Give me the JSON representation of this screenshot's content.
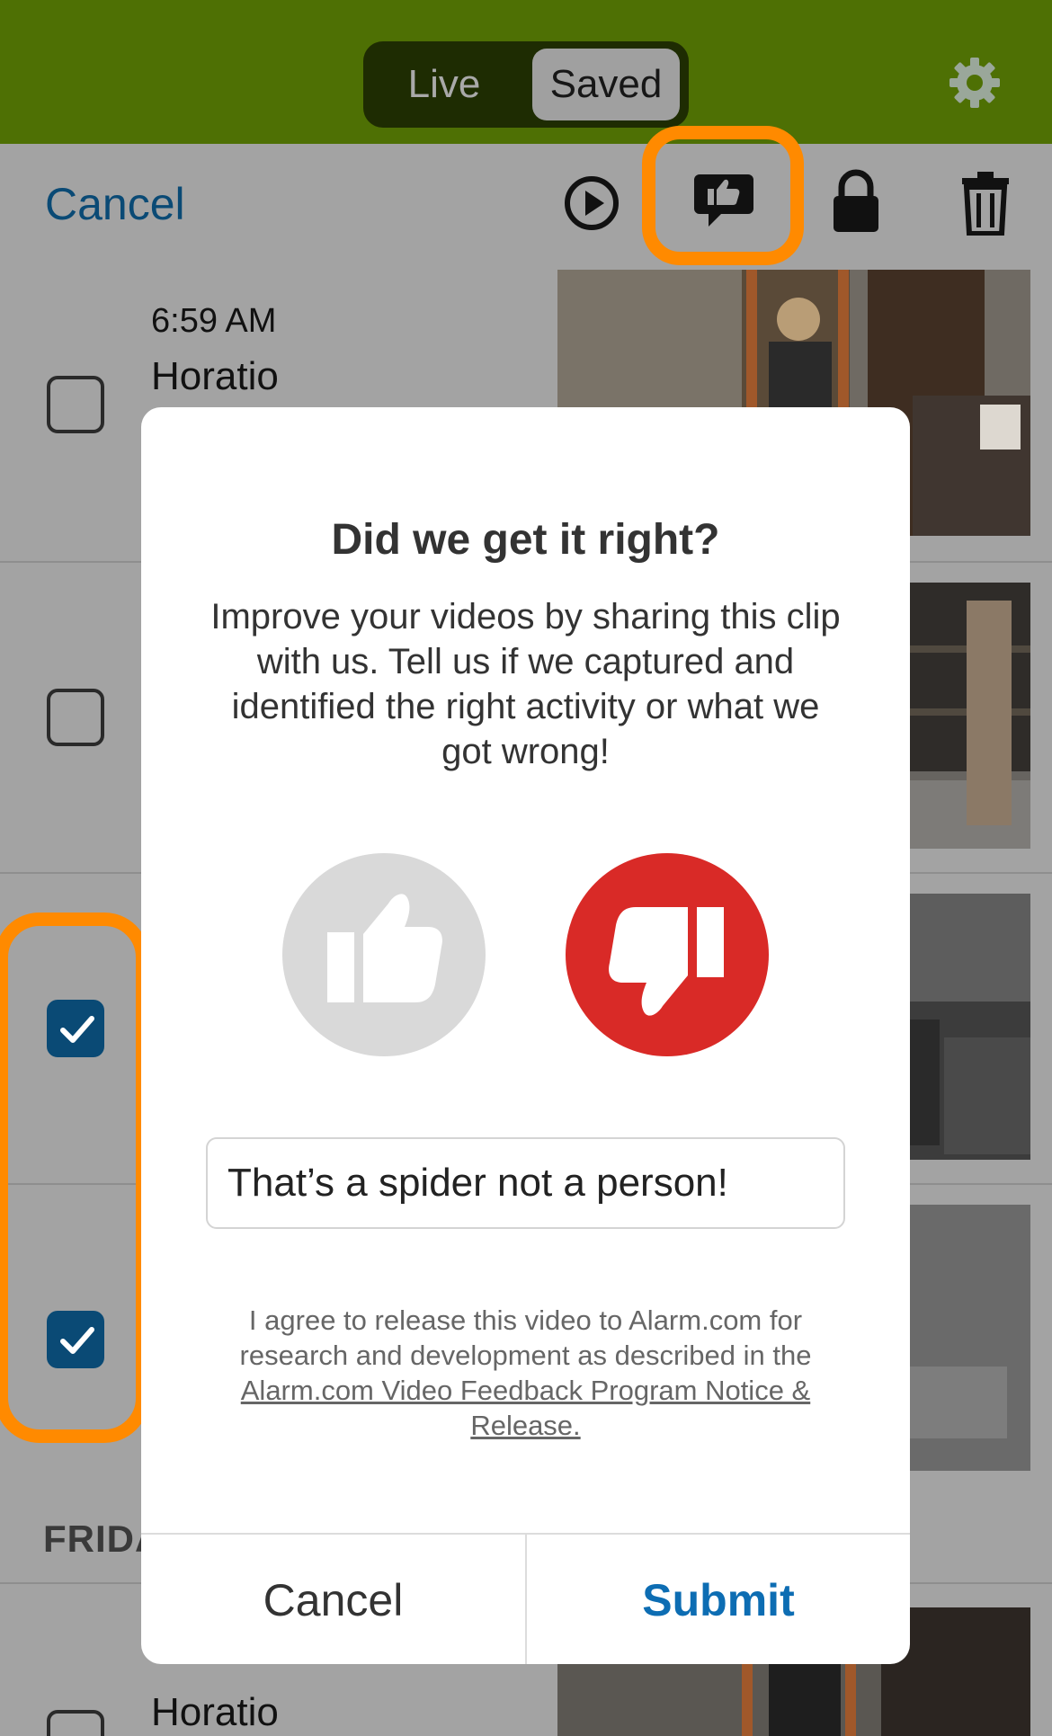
{
  "header": {
    "segments": [
      {
        "label": "Live",
        "selected": false
      },
      {
        "label": "Saved",
        "selected": true
      }
    ],
    "settings_icon": "gear-icon",
    "bar_color": "#4e7004"
  },
  "toolbar": {
    "cancel_label": "Cancel",
    "icons": [
      "play-icon",
      "feedback-thumbs-up-icon",
      "lock-icon",
      "trash-icon"
    ],
    "highlight_color": "#ff8a00"
  },
  "list": {
    "rows": [
      {
        "time": "6:59 AM",
        "name": "Horatio",
        "checked": false
      },
      {
        "time": "",
        "name": "",
        "checked": false
      },
      {
        "time": "",
        "name": "",
        "checked": true
      },
      {
        "time": "",
        "name": "",
        "checked": true
      }
    ],
    "section_label": "FRIDA",
    "last_row": {
      "time": "",
      "name": "Horatio",
      "checked": false
    }
  },
  "modal": {
    "title": "Did we get it right?",
    "body": "Improve your videos by sharing this clip with us. Tell us if we captured and identified the right activity or what we got wrong!",
    "vote_icons": [
      "thumbs-up-icon",
      "thumbs-down-icon"
    ],
    "selected_vote": "thumbs-down",
    "comment_value": "That’s a spider not a person!",
    "consent_prefix": "I agree to release this video to Alarm.com for research and development as described in the ",
    "consent_link": "Alarm.com Video Feedback Program Notice & Release.",
    "cancel_label": "Cancel",
    "submit_label": "Submit",
    "accent_color": "#0d6db3",
    "down_color": "#d92a27"
  }
}
